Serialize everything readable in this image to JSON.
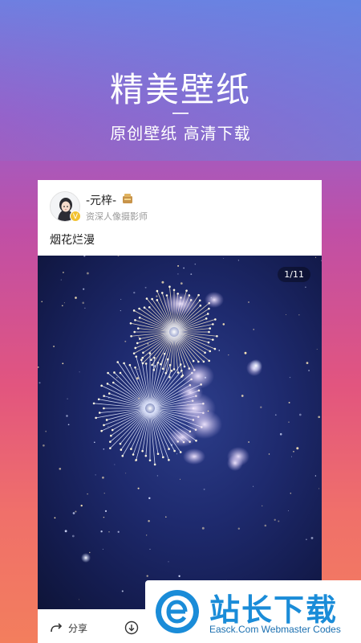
{
  "hero": {
    "title": "精美壁纸",
    "subtitle": "原创壁纸 高清下载"
  },
  "post": {
    "username": "-元梓-",
    "user_title": "资深人像摄影师",
    "caption": "烟花烂漫",
    "page_indicator": "1/11",
    "verified_mark": "V",
    "share_label": "分享"
  },
  "watermark": {
    "title": "站长下载",
    "subtitle": "Easck.Com Webmaster Codes"
  },
  "colors": {
    "accent": "#1a8cd8",
    "badge": "#f2c232",
    "sky": "#1e2a6e"
  },
  "icons": [
    "share-icon",
    "download-icon",
    "verified-icon",
    "level-icon",
    "site-logo-icon"
  ]
}
